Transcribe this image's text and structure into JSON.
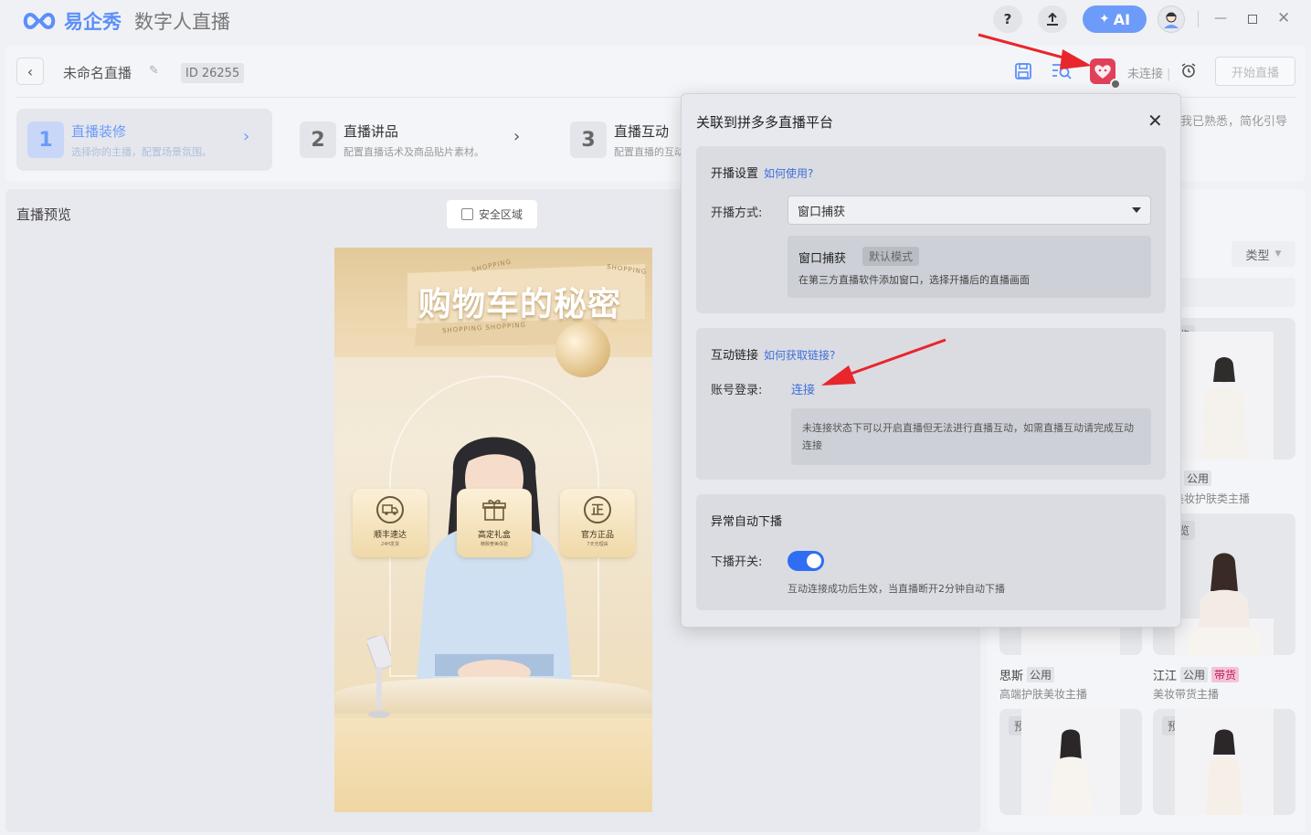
{
  "app": {
    "brand": "易企秀",
    "product": "数字人直播"
  },
  "titlebar": {
    "help": "?",
    "ai_label": "AI"
  },
  "header": {
    "title": "未命名直播",
    "id_prefix": "ID",
    "id_value": "26255",
    "status": "未连接",
    "start_button": "开始直播",
    "hint_right": "我已熟悉，简化引导"
  },
  "steps": [
    {
      "num": "1",
      "title": "直播装修",
      "desc": "选择你的主播，配置场景氛围。"
    },
    {
      "num": "2",
      "title": "直播讲品",
      "desc": "配置直播话术及商品贴片素材。"
    },
    {
      "num": "3",
      "title": "直播互动",
      "desc": "配置直播的互动"
    }
  ],
  "preview": {
    "label": "直播预览",
    "safe_area": "安全区域",
    "banner_title": "购物车的秘密",
    "shop_tag": "SHOPPING",
    "shop_tag2": "SHOPPING SHOPPING",
    "features": [
      {
        "title": "顺丰速达",
        "sub": "24H发货",
        "icon": "truck-icon"
      },
      {
        "title": "高定礼盒",
        "sub": "精致奢美体验",
        "icon": "gift-icon"
      },
      {
        "title": "官方正品",
        "sub": "7天无理由",
        "icon": "zheng-icon",
        "glyph": "正"
      }
    ]
  },
  "right_panel": {
    "type_filter": "类型",
    "preview_tag": "预览",
    "public_tag": "公用",
    "goods_tag": "带货",
    "cards": [
      {
        "name": "",
        "desc": "美妆护肤类主播"
      },
      {
        "name": "思斯",
        "desc": "高端护肤美妆主播"
      },
      {
        "name": "江江",
        "desc": "美妆带货主播"
      }
    ]
  },
  "modal": {
    "title": "关联到拼多多直播平台",
    "section1": {
      "heading": "开播设置",
      "help": "如何使用?",
      "mode_label": "开播方式:",
      "mode_value": "窗口捕获",
      "info_title": "窗口捕获",
      "info_tag": "默认模式",
      "info_desc": "在第三方直播软件添加窗口，选择开播后的直播画面"
    },
    "section2": {
      "heading": "互动链接",
      "help": "如何获取链接?",
      "account_label": "账号登录:",
      "connect": "连接",
      "warning": "未连接状态下可以开启直播但无法进行直播互动，如需直播互动请完成互动连接"
    },
    "section3": {
      "heading": "异常自动下播",
      "switch_label": "下播开关:",
      "switch_on": true,
      "switch_desc": "互动连接成功后生效，当直播断开2分钟自动下播"
    }
  },
  "colors": {
    "accent": "#6d9bf9",
    "link": "#3f6fd8",
    "toggle": "#2f6df2",
    "pdd": "#e0405a",
    "arrow": "#e8262b"
  }
}
